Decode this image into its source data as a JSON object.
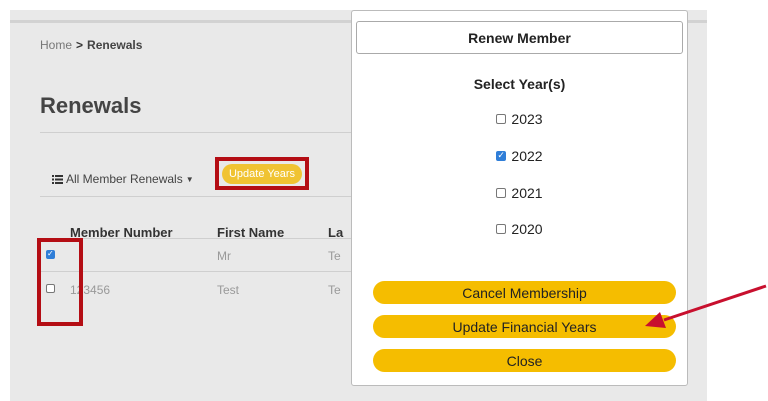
{
  "breadcrumb": {
    "home": "Home",
    "separator": ">",
    "current": "Renewals"
  },
  "page": {
    "title": "Renewals"
  },
  "toolbar": {
    "filter_label": "All Member Renewals",
    "update_years_label": "Update Years"
  },
  "table": {
    "headers": [
      "Member Number",
      "First Name",
      "La"
    ],
    "rows": [
      {
        "checked": true,
        "member_number": "",
        "first_name": "Mr",
        "last_name": "Te"
      },
      {
        "checked": false,
        "member_number": "123456",
        "first_name": "Test",
        "last_name": "Te"
      }
    ]
  },
  "modal": {
    "title": "Renew Member",
    "subtitle": "Select Year(s)",
    "years": [
      {
        "label": "2023",
        "checked": false
      },
      {
        "label": "2022",
        "checked": true
      },
      {
        "label": "2021",
        "checked": false
      },
      {
        "label": "2020",
        "checked": false
      }
    ],
    "buttons": {
      "cancel": "Cancel Membership",
      "update": "Update Financial Years",
      "close": "Close"
    }
  },
  "colors": {
    "button_yellow": "#f5bd00",
    "highlight_red": "#b40d14",
    "arrow_red": "#c8102e",
    "check_blue": "#2f7ed8"
  }
}
